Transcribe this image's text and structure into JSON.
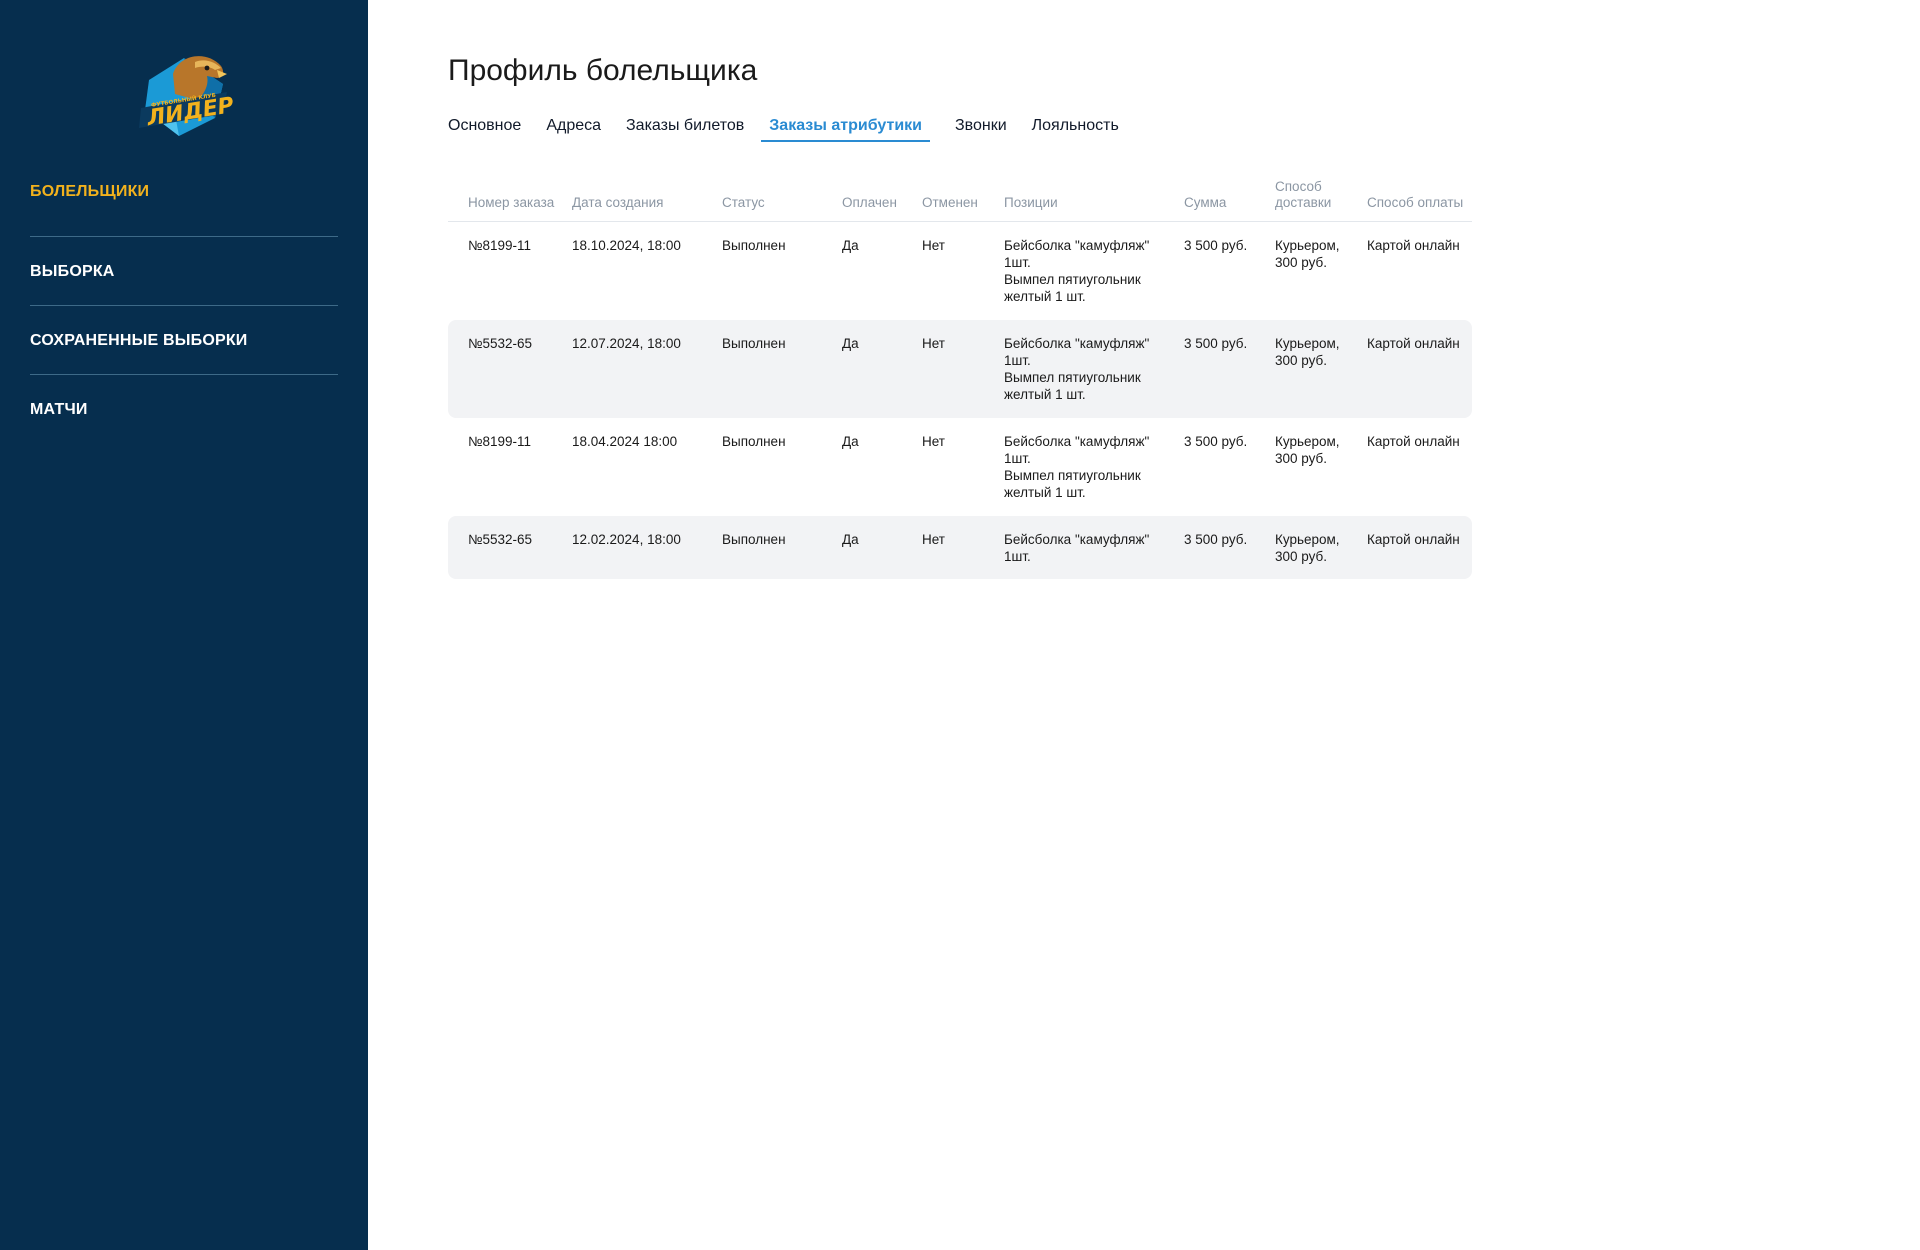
{
  "sidebar": {
    "logo": {
      "icon": "eagle-club-logo",
      "text": "ЛИДЕР",
      "subtext": "ФУТБОЛЬНЫЙ КЛУБ",
      "colors": {
        "shield": "#1b9ad6",
        "shield_dark": "#0f6fa8",
        "text": "#f2b21d",
        "bird": "#c8862a"
      }
    },
    "items": [
      {
        "label": "БОЛЕЛЬЩИКИ",
        "active": true
      },
      {
        "label": "ВЫБОРКА",
        "active": false
      },
      {
        "label": "СОХРАНЕННЫЕ ВЫБОРКИ",
        "active": false
      },
      {
        "label": "МАТЧИ",
        "active": false
      }
    ]
  },
  "main": {
    "title": "Профиль болельщика",
    "tabs": [
      {
        "label": "Основное",
        "active": false
      },
      {
        "label": "Адреса",
        "active": false
      },
      {
        "label": "Заказы билетов",
        "active": false
      },
      {
        "label": "Заказы атрибутики",
        "active": true
      },
      {
        "label": "Звонки",
        "active": false
      },
      {
        "label": "Лояльность",
        "active": false
      }
    ],
    "table": {
      "headers": [
        "Номер заказа",
        "Дата создания",
        "Статус",
        "Оплачен",
        "Отменен",
        "Позиции",
        "Сумма",
        "Способ доставки",
        "Способ оплаты"
      ],
      "rows": [
        {
          "number": "№8199-11",
          "date": "18.10.2024, 18:00",
          "status": "Выполнен",
          "paid": "Да",
          "cancelled": "Нет",
          "items": [
            "Бейсболка \"камуфляж\"",
            "1шт.",
            "Вымпел пятиугольник",
            "желтый 1 шт."
          ],
          "sum": "3 500 руб.",
          "delivery": "Курьером, 300 руб.",
          "payment": "Картой онлайн"
        },
        {
          "number": "№5532-65",
          "date": "12.07.2024, 18:00",
          "status": "Выполнен",
          "paid": "Да",
          "cancelled": "Нет",
          "items": [
            "Бейсболка \"камуфляж\"",
            "1шт.",
            "Вымпел пятиугольник",
            "желтый 1 шт."
          ],
          "sum": "3 500 руб.",
          "delivery": "Курьером, 300 руб.",
          "payment": "Картой онлайн"
        },
        {
          "number": "№8199-11",
          "date": "18.04.2024 18:00",
          "status": "Выполнен",
          "paid": "Да",
          "cancelled": "Нет",
          "items": [
            "Бейсболка \"камуфляж\"",
            "1шт.",
            "Вымпел пятиугольник",
            "желтый 1 шт."
          ],
          "sum": "3 500 руб.",
          "delivery": "Курьером, 300 руб.",
          "payment": "Картой онлайн"
        },
        {
          "number": "№5532-65",
          "date": "12.02.2024, 18:00",
          "status": "Выполнен",
          "paid": "Да",
          "cancelled": "Нет",
          "items": [
            "Бейсболка \"камуфляж\"",
            "1шт."
          ],
          "sum": "3 500 руб.",
          "delivery": "Курьером, 300 руб.",
          "payment": "Картой онлайн"
        }
      ]
    }
  },
  "colors": {
    "sidebar_bg": "#062e4e",
    "active_nav": "#f2b21d",
    "active_tab": "#2a8bd2",
    "header_text": "#8b96a3",
    "row_shade": "#f2f3f5"
  }
}
